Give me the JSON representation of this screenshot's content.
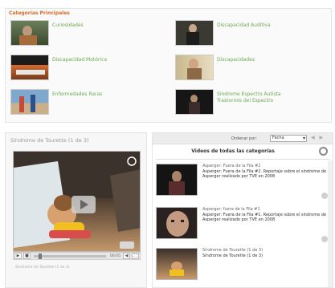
{
  "categories": {
    "title": "Categorías Principales",
    "items": [
      {
        "label": "Curiosidades"
      },
      {
        "label": "Discapacidad Auditiva"
      },
      {
        "label": "Discapacidad Motórica"
      },
      {
        "label": "Discapacidades"
      },
      {
        "label": "Enfermedades Raras"
      },
      {
        "label": "Síndrome Espectro Autista",
        "label2": "Trastornos del Espectro"
      }
    ]
  },
  "player": {
    "title": "Síndrome de Tourette (1 de 3)",
    "caption": "Síndrome de Tourette (1 de 3)",
    "controls": {
      "play": "▶",
      "stop": "■",
      "volume": "◀",
      "fullscreen": "⛶",
      "time": "00:05"
    }
  },
  "list": {
    "order_label": "Ordenar por:",
    "order_value": "Fecha",
    "title": "Videos de todas las categorías",
    "items": [
      {
        "head": "Asperger: Fuera de la Fila #2",
        "desc": "Asperger: Fuera de la Fila #2. Reportaje sobre el síndrome de Asperger realizado por TVE en 2008"
      },
      {
        "head": "Asperger: fuera de la Fila #1",
        "desc": "Asperger: Fuera de la Fila #1. Reportaje sobre el síndrome de Asperger realizado por TVE en 2008"
      },
      {
        "head": "Síndrome de Tourette (1 de 3)",
        "desc": "Síndrome de Tourette (1 de 3)"
      }
    ]
  },
  "colors": {
    "category_title": "#d26a2a",
    "category_link": "#6aa84f"
  }
}
